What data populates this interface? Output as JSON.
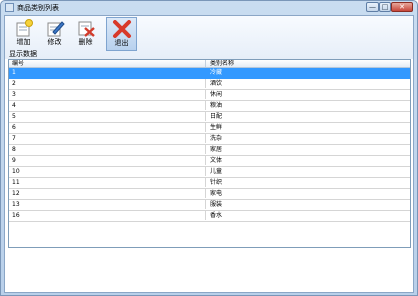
{
  "window": {
    "title": "商品类别列表",
    "min": "—",
    "max": "□",
    "close": "✕"
  },
  "toolbar": {
    "add_label": "增加",
    "edit_label": "修改",
    "delete_label": "删除",
    "exit_label": "退出"
  },
  "status_text": "显示数据",
  "grid": {
    "columns": [
      "编号",
      "类别名称"
    ],
    "rows": [
      [
        "1",
        "冷藏"
      ],
      [
        "2",
        "酒饮"
      ],
      [
        "3",
        "休闲"
      ],
      [
        "4",
        "粮油"
      ],
      [
        "5",
        "日配"
      ],
      [
        "6",
        "生鲜"
      ],
      [
        "7",
        "洗杂"
      ],
      [
        "8",
        "家居"
      ],
      [
        "9",
        "文体"
      ],
      [
        "10",
        "儿童"
      ],
      [
        "11",
        "针织"
      ],
      [
        "12",
        "家电"
      ],
      [
        "13",
        "服装"
      ],
      [
        "16",
        "香水"
      ]
    ],
    "selected_row_index": 0
  },
  "colors": {
    "selection": "#3399ff",
    "chrome": "#c9dcf0"
  }
}
